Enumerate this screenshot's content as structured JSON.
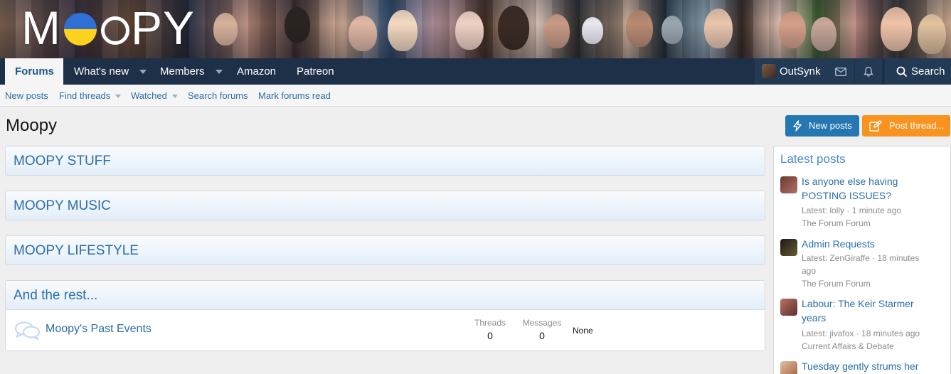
{
  "header": {
    "logo_text_left": "M",
    "logo_text_right": "PY"
  },
  "nav": {
    "items": [
      {
        "label": "Forums"
      },
      {
        "label": "What's new"
      },
      {
        "label": "Members"
      },
      {
        "label": "Amazon"
      },
      {
        "label": "Patreon"
      }
    ],
    "user": "OutSynk",
    "search_label": "Search"
  },
  "subnav": {
    "items": [
      {
        "label": "New posts"
      },
      {
        "label": "Find threads"
      },
      {
        "label": "Watched"
      },
      {
        "label": "Search forums"
      },
      {
        "label": "Mark forums read"
      }
    ]
  },
  "page": {
    "title": "Moopy",
    "new_posts_label": "New posts",
    "post_thread_label": "Post thread..."
  },
  "categories": [
    {
      "title": "MOOPY STUFF"
    },
    {
      "title": "MOOPY MUSIC"
    },
    {
      "title": "MOOPY LIFESTYLE"
    },
    {
      "title": "And the rest...",
      "node": {
        "title": "Moopy's Past Events",
        "threads_label": "Threads",
        "threads": "0",
        "messages_label": "Messages",
        "messages": "0",
        "latest": "None"
      }
    }
  ],
  "sidebar": {
    "title": "Latest posts",
    "posts": [
      {
        "title_line1": "Is anyone else having",
        "title_line2": "POSTING ISSUES?",
        "meta_line1": "Latest: lolly · 1 minute ago",
        "meta_line2": "",
        "forum": "The Forum Forum"
      },
      {
        "title_line1": "Admin Requests",
        "title_line2": "",
        "meta_line1": "Latest: ZenGiraffe · 18 minutes",
        "meta_line2": "ago",
        "forum": "The Forum Forum"
      },
      {
        "title_line1": "Labour: The Keir Starmer",
        "title_line2": "years",
        "meta_line1": "Latest: jivafox · 18 minutes ago",
        "meta_line2": "",
        "forum": "Current Affairs & Debate"
      },
      {
        "title_line1": "Tuesday gently strums her",
        "title_line2": "",
        "meta_line1": "",
        "meta_line2": "",
        "forum": ""
      }
    ]
  },
  "colors": {
    "nav_bg": "#1d3048",
    "link": "#2b6eaa",
    "btn_blue": "#2577b1",
    "btn_orange": "#f7931e"
  }
}
